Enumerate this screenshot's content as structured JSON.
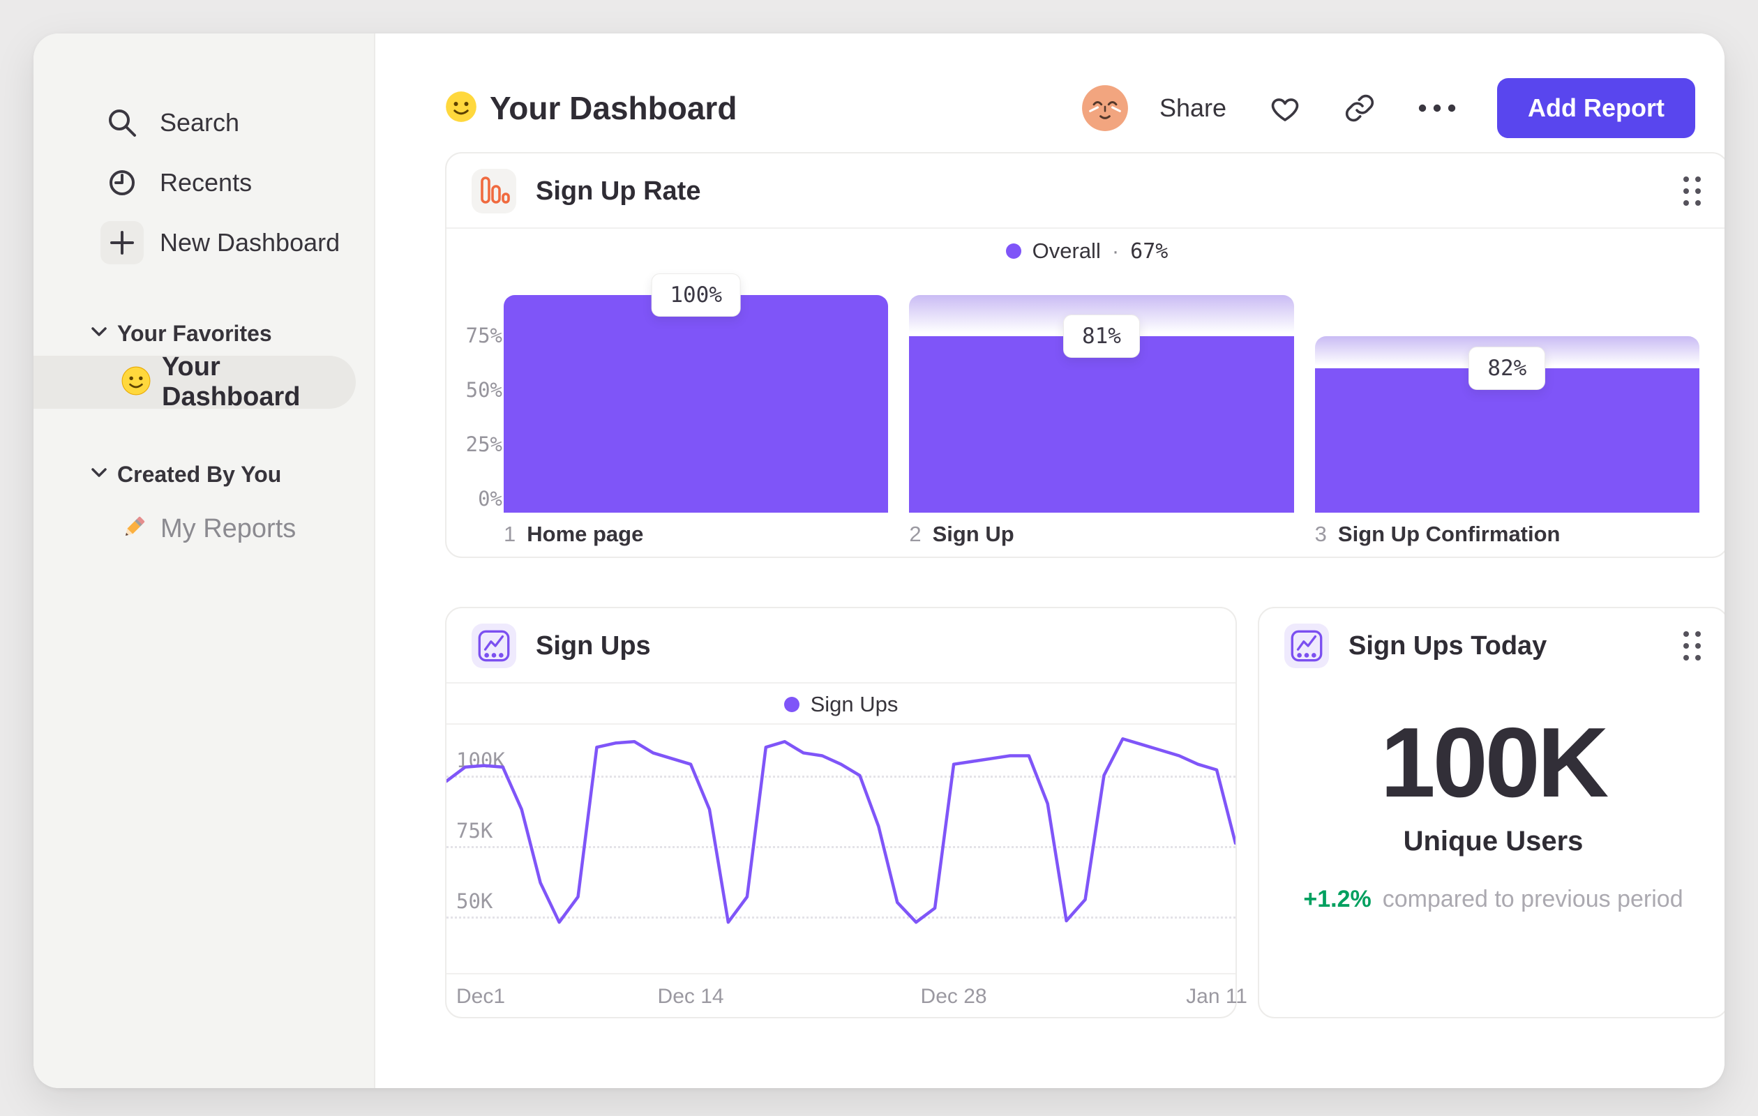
{
  "colors": {
    "accent_purple": "#7F55F8",
    "funnel_gradient_top": "#C9BBF4",
    "button_purple": "#5946EE",
    "positive_green": "#00A05F",
    "funnel_icon_orange": "#F06A3F",
    "sidebar_bg": "#F4F4F2"
  },
  "sidebar": {
    "items": [
      {
        "icon": "search-icon",
        "label": "Search"
      },
      {
        "icon": "clock-icon",
        "label": "Recents"
      },
      {
        "icon": "plus-icon",
        "label": "New Dashboard"
      }
    ],
    "sections": [
      {
        "label": "Your Favorites",
        "items": [
          {
            "icon": "smiley-emoji",
            "label": "Your Dashboard",
            "selected": true
          }
        ]
      },
      {
        "label": "Created By You",
        "items": [
          {
            "icon": "pencil-emoji",
            "label": "My Reports",
            "selected": false
          }
        ]
      }
    ]
  },
  "header": {
    "emoji": "smiley-emoji",
    "title": "Your Dashboard",
    "avatar": "relieved-face-avatar",
    "share_label": "Share",
    "icons": [
      "heart-icon",
      "link-icon",
      "ellipsis-icon"
    ],
    "add_report_label": "Add Report"
  },
  "funnel_card": {
    "title": "Sign Up Rate",
    "legend_label": "Overall",
    "legend_sep": "·",
    "legend_value": "67%"
  },
  "line_card": {
    "title": "Sign Ups",
    "legend_label": "Sign Ups"
  },
  "today_card": {
    "title": "Sign Ups Today",
    "value": "100K",
    "label": "Unique Users",
    "delta": "+1.2%",
    "delta_note": "compared to previous period"
  },
  "chart_data": [
    {
      "type": "bar",
      "subtype": "funnel",
      "title": "Sign Up Rate",
      "legend": [
        "Overall · 67%"
      ],
      "legend_position": "top-center",
      "categories": [
        "Home page",
        "Sign Up",
        "Sign Up Confirmation"
      ],
      "step_numbers": [
        "1",
        "2",
        "3"
      ],
      "step_conversion_labels": [
        "100%",
        "81%",
        "82%"
      ],
      "absolute_pct": [
        100,
        81,
        66.4
      ],
      "ytick_values": [
        75,
        50,
        25,
        0
      ],
      "ytick_labels": [
        "75%",
        "50%",
        "25%",
        "0%"
      ],
      "ylim": [
        0,
        100
      ],
      "grid": false
    },
    {
      "type": "line",
      "title": "Sign Ups",
      "legend": [
        "Sign Ups"
      ],
      "legend_position": "top-center",
      "xlabel": "",
      "ylabel": "",
      "ylim": [
        30,
        118
      ],
      "ytick_values": [
        100,
        75,
        50
      ],
      "ytick_labels": [
        "100K",
        "75K",
        "50K"
      ],
      "grid": "dotted-horizontal",
      "xticks": [
        {
          "label": "Dec1",
          "day": 0
        },
        {
          "label": "Dec 14",
          "day": 13
        },
        {
          "label": "Dec 28",
          "day": 27
        },
        {
          "label": "Jan 11",
          "day": 41
        }
      ],
      "total_days": 42,
      "values_unit": "K",
      "values": [
        98,
        103,
        103.5,
        103,
        88,
        62,
        48,
        57,
        110,
        111.5,
        112,
        108,
        106,
        104,
        88,
        48,
        57,
        110,
        112,
        108,
        107,
        104,
        100,
        82,
        55,
        48,
        53,
        104,
        105,
        106,
        107,
        107,
        90,
        48.5,
        56,
        100,
        113,
        111,
        109,
        107,
        104,
        102,
        76
      ]
    },
    {
      "type": "big_number",
      "title": "Sign Ups Today",
      "value": "100K",
      "label": "Unique Users",
      "delta": "+1.2%",
      "delta_note": "compared to previous period"
    }
  ]
}
